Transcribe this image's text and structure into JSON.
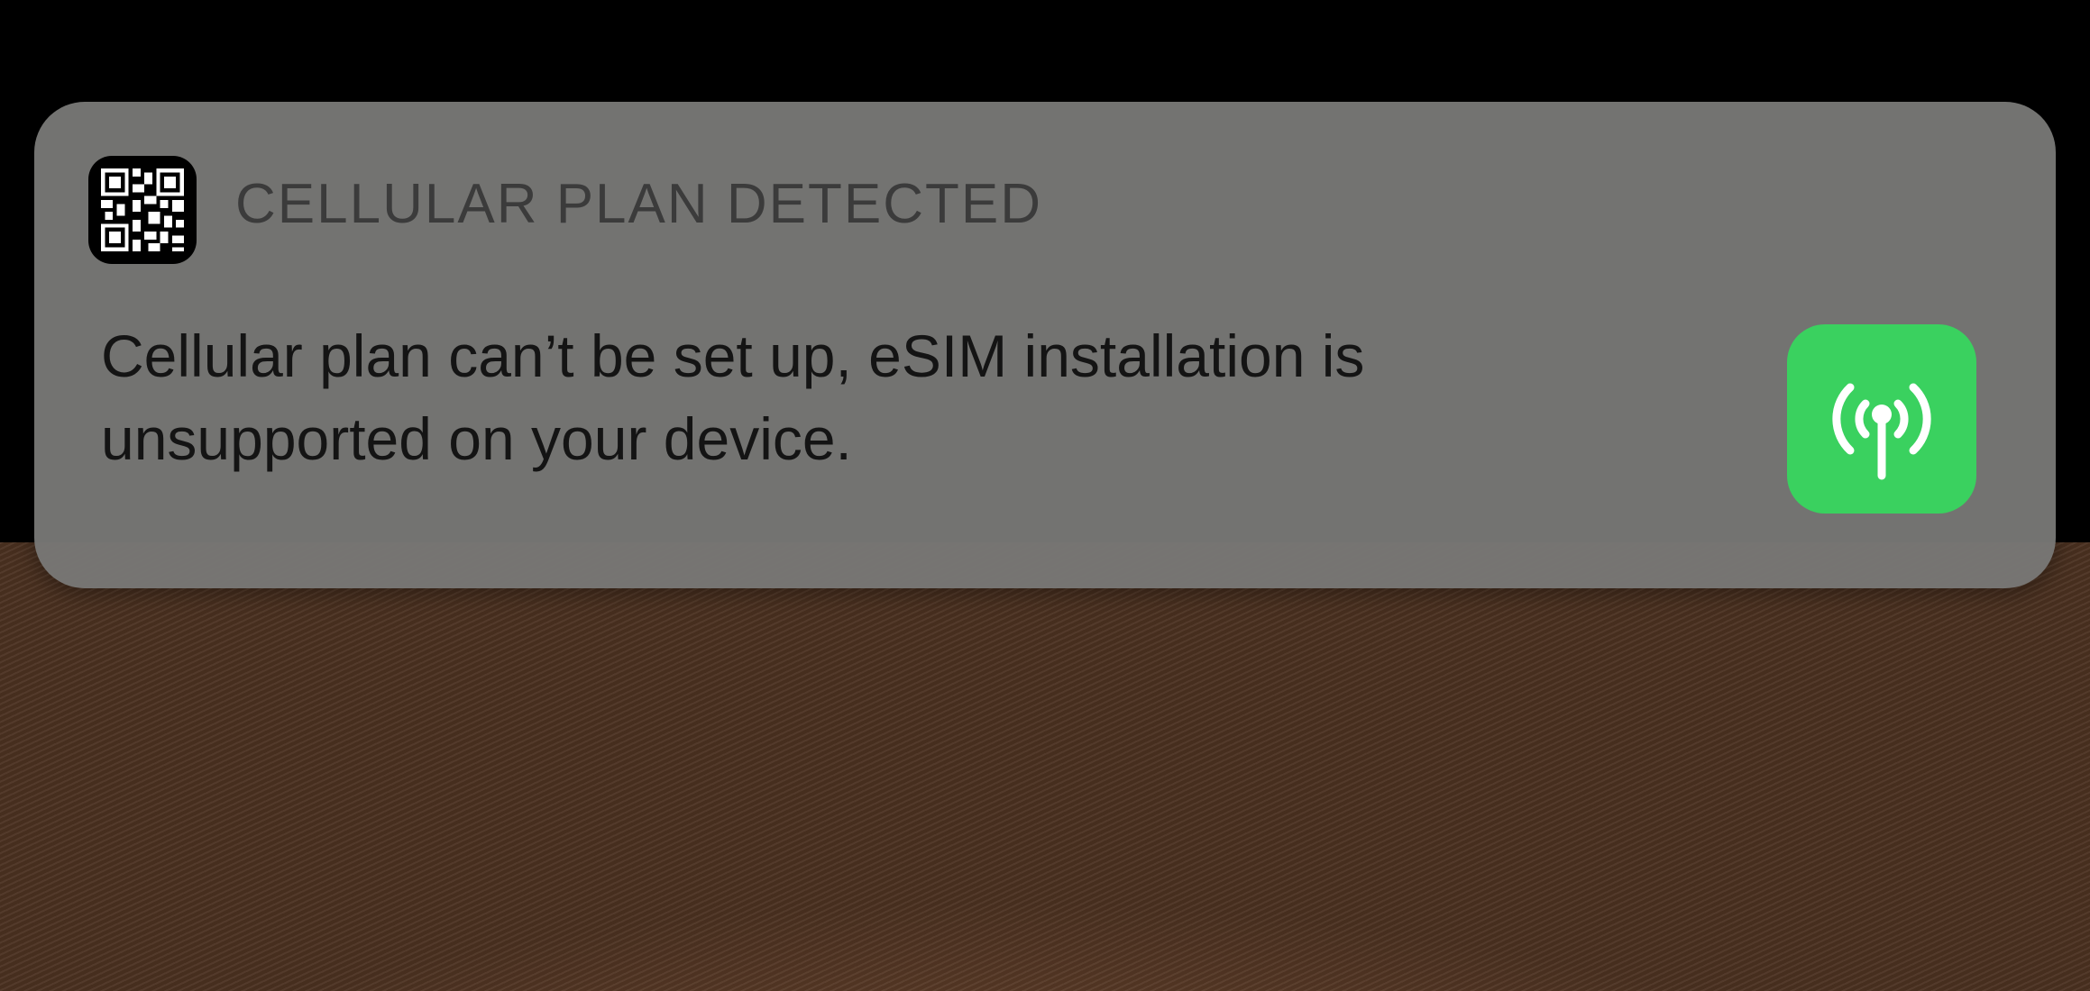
{
  "notification": {
    "app_icon": "qr-code-icon",
    "app_name": "CELLULAR PLAN DETECTED",
    "message_line1": "Cellular plan can’t be set up, eSIM installation is",
    "message_line2": "unsupported on your device.",
    "attachment_icon": "cellular-antenna-icon",
    "attachment_color": "#3ad15f"
  }
}
